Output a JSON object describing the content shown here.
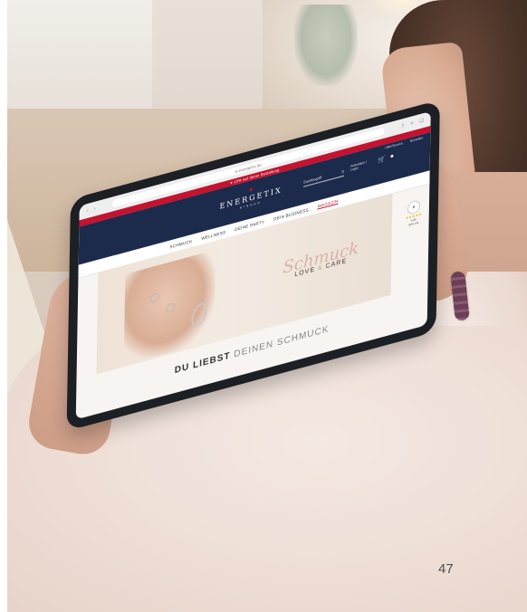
{
  "tablet": {
    "browser": {
      "url": "a.energetix.de",
      "icons": [
        "share-icon",
        "plus-icon",
        "tabs-icon"
      ]
    },
    "promo_strip": "♥ 15% auf deine Bestellung",
    "top_links": [
      "Hilfe/Service",
      "Bestellen"
    ],
    "logo": {
      "name": "ENERGETIX",
      "sub": "BINGEN"
    },
    "search_placeholder": "Suchbegriff",
    "account_label": "Anmelden / Login",
    "nav": [
      "SCHMUCK",
      "WELLNESS",
      "DEINE PARTY",
      "DEIN BUSINESS",
      "MAGAZIN"
    ],
    "hero": {
      "script": "Schmuck",
      "caption_left": "LOVE",
      "caption_amp": "&",
      "caption_right": "CARE"
    },
    "badge": {
      "icon": "trusted-shops-icon",
      "letter": "e",
      "stars": "★★★★★",
      "score": "4.86",
      "label": "Sehr gut"
    },
    "headline_strong": "DU LIEBST",
    "headline_light": "DEINEN SCHMUCK"
  },
  "page_number": "47"
}
